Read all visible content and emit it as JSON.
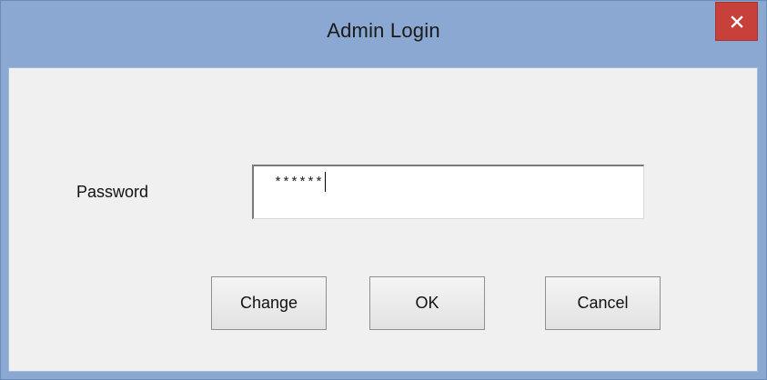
{
  "window": {
    "title": "Admin Login",
    "close_icon": "close-icon",
    "accent": "#8aa8d2",
    "close_color": "#c7413a"
  },
  "form": {
    "password_label": "Password",
    "password_value": "******"
  },
  "buttons": {
    "change_label": "Change",
    "ok_label": "OK",
    "cancel_label": "Cancel"
  }
}
